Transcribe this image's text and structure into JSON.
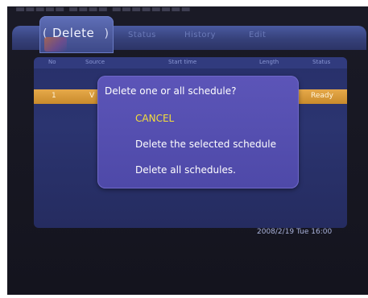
{
  "tabs": {
    "active": "Delete",
    "others": [
      "Status",
      "History",
      "Edit"
    ]
  },
  "table": {
    "headers": [
      "No",
      "Source",
      "Start time",
      "Length",
      "Status"
    ],
    "rows": [
      {
        "no": "1",
        "source": "V",
        "status": "Ready"
      }
    ]
  },
  "dialog": {
    "prompt": "Delete one or all schedule?",
    "options": [
      "CANCEL",
      "Delete the selected schedule",
      "Delete all schedules."
    ]
  },
  "footer": {
    "datetime": "2008/2/19 Tue 16:00"
  },
  "colors": {
    "highlight_text": "#f5df3a",
    "selected_row": "#d9992f",
    "dialog_bg": "#5550b0"
  }
}
